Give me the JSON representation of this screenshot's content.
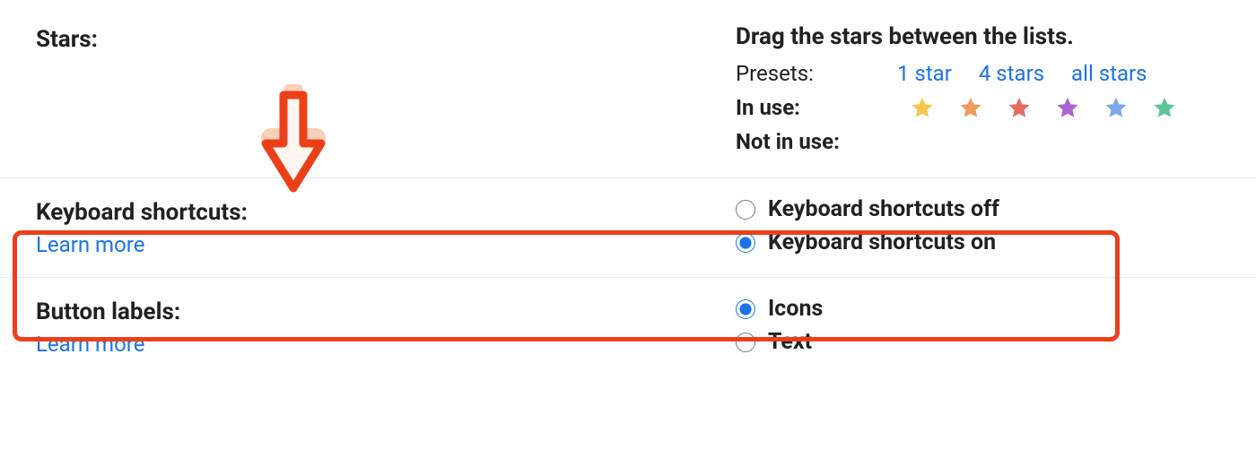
{
  "stars": {
    "label": "Stars:",
    "instruction": "Drag the stars between the lists.",
    "presets_label": "Presets:",
    "presets": [
      "1 star",
      "4 stars",
      "all stars"
    ],
    "in_use_label": "In use:",
    "not_in_use_label": "Not in use:",
    "star_colors": [
      "#f6c74a",
      "#f29a5a",
      "#e86a63",
      "#ab63cf",
      "#7da9ec",
      "#60c49b"
    ]
  },
  "keyboard_shortcuts": {
    "label": "Keyboard shortcuts:",
    "learn_more": "Learn more",
    "options": [
      "Keyboard shortcuts off",
      "Keyboard shortcuts on"
    ],
    "selected_index": 1
  },
  "button_labels": {
    "label": "Button labels:",
    "learn_more": "Learn more",
    "options": [
      "Icons",
      "Text"
    ],
    "selected_index": 0
  }
}
